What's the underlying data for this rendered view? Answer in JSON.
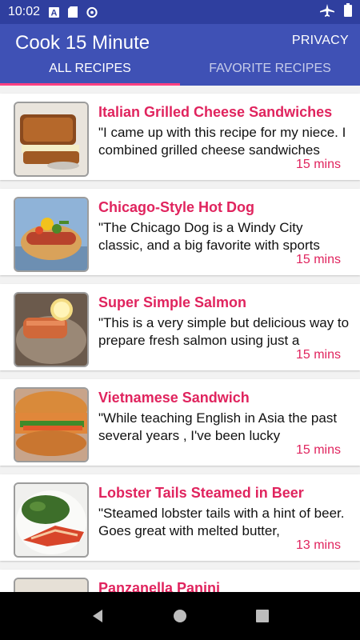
{
  "status": {
    "time": "10:02",
    "icons": [
      "text-a-icon",
      "sd-card-icon",
      "sync-icon"
    ],
    "right_icons": [
      "airplane-icon",
      "battery-icon"
    ]
  },
  "app": {
    "title": "Cook 15 Minute",
    "privacy_label": "PRIVACY"
  },
  "tabs": [
    {
      "label": "ALL RECIPES",
      "active": true
    },
    {
      "label": "FAVORITE RECIPES",
      "active": false
    }
  ],
  "recipes": [
    {
      "title": "Italian Grilled Cheese Sandwiches",
      "desc": "\"I came up with this recipe for my niece. I combined grilled cheese sandwiches",
      "time": "15 mins"
    },
    {
      "title": "Chicago-Style Hot Dog",
      "desc": "\"The Chicago Dog is a Windy City classic, and a big favorite with sports",
      "time": "15 mins"
    },
    {
      "title": "Super Simple Salmon",
      "desc": "\"This is a very simple but delicious way to prepare fresh salmon using just a",
      "time": "15 mins"
    },
    {
      "title": "Vietnamese Sandwich",
      "desc": "\"While teaching English in Asia the past several years , I've been lucky",
      "time": "15 mins"
    },
    {
      "title": "Lobster Tails Steamed in Beer",
      "desc": "\"Steamed lobster tails with a hint of beer. Goes great with melted butter,",
      "time": "13 mins"
    },
    {
      "title": "Panzanella Panini",
      "desc": "",
      "time": ""
    }
  ],
  "colors": {
    "status_bar": "#2f3f9f",
    "app_bar": "#3f51b5",
    "accent": "#e0245e",
    "tab_indicator": "#ff4081"
  },
  "nav": [
    "back-icon",
    "home-icon",
    "recents-icon"
  ]
}
